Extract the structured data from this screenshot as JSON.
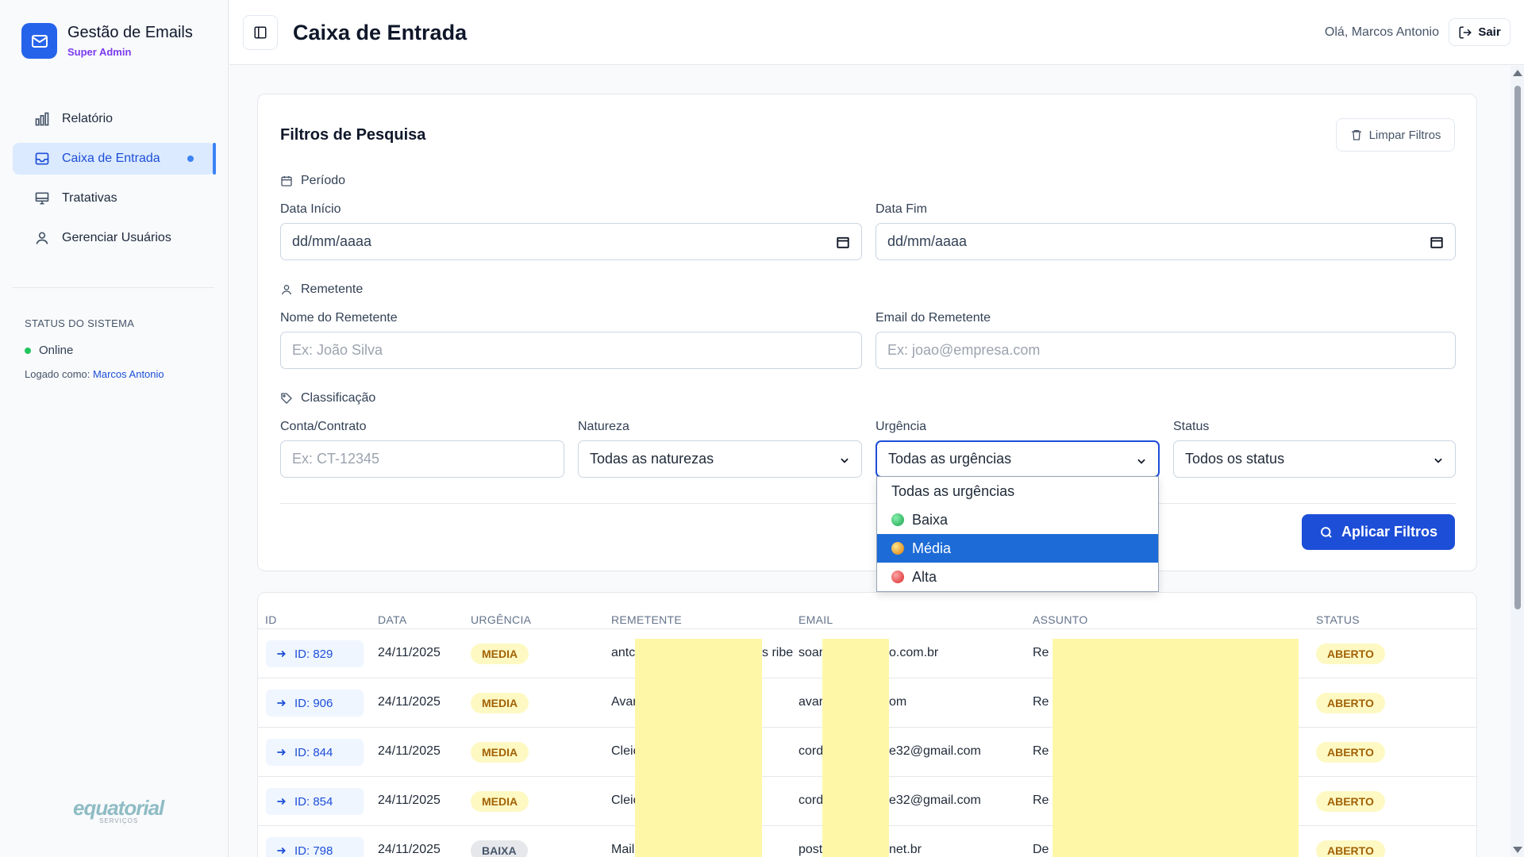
{
  "sidebar": {
    "brand_title": "Gestão de Emails",
    "brand_role": "Super Admin",
    "nav": [
      {
        "label": "Relatório",
        "icon": "bar-chart-icon"
      },
      {
        "label": "Caixa de Entrada",
        "icon": "inbox-icon",
        "active": true
      },
      {
        "label": "Tratativas",
        "icon": "monitor-icon"
      },
      {
        "label": "Gerenciar Usuários",
        "icon": "user-icon"
      }
    ],
    "status_title": "STATUS DO SISTEMA",
    "status_value": "Online",
    "logged_prefix": "Logado como:",
    "logged_user": "Marcos Antonio",
    "footer_logo": "equatorial",
    "footer_logo_sub": "SERVIÇOS"
  },
  "header": {
    "title": "Caixa de Entrada",
    "greeting": "Olá, Marcos Antonio",
    "logout_label": "Sair"
  },
  "filters": {
    "title": "Filtros de Pesquisa",
    "clear_label": "Limpar Filtros",
    "periodo_label": "Período",
    "data_inicio_label": "Data Início",
    "data_inicio_value": "dd/mm/aaaa",
    "data_fim_label": "Data Fim",
    "data_fim_value": "dd/mm/aaaa",
    "remetente_label": "Remetente",
    "nome_label": "Nome do Remetente",
    "nome_placeholder": "Ex: João Silva",
    "email_label": "Email do Remetente",
    "email_placeholder": "Ex: joao@empresa.com",
    "classificacao_label": "Classificação",
    "conta_label": "Conta/Contrato",
    "conta_placeholder": "Ex: CT-12345",
    "natureza_label": "Natureza",
    "natureza_value": "Todas as naturezas",
    "urgencia_label": "Urgência",
    "urgencia_value": "Todas as urgências",
    "status_label": "Status",
    "status_value": "Todos os status",
    "apply_label": "Aplicar Filtros"
  },
  "urgencia_dropdown": {
    "options": [
      {
        "label": "Todas as urgências",
        "color": ""
      },
      {
        "label": "Baixa",
        "color": "#22c55e"
      },
      {
        "label": "Média",
        "color": "#eab308",
        "selected": true
      },
      {
        "label": "Alta",
        "color": "#ef4444"
      }
    ]
  },
  "table": {
    "headers": [
      "ID",
      "DATA",
      "URGÊNCIA",
      "REMETENTE",
      "EMAIL",
      "ASSUNTO",
      "STATUS"
    ],
    "rows": [
      {
        "id": "ID: 829",
        "date": "24/11/2025",
        "urgency": "MEDIA",
        "sender_start": "antc",
        "sender_end": "s ribe",
        "email_start": "soar",
        "email_end": "o.com.br",
        "subject": "Re",
        "status": "ABERTO"
      },
      {
        "id": "ID: 906",
        "date": "24/11/2025",
        "urgency": "MEDIA",
        "sender_start": "Avar",
        "sender_end": "",
        "email_start": "avar",
        "email_end": "om",
        "subject": "Re",
        "status": "ABERTO"
      },
      {
        "id": "ID: 844",
        "date": "24/11/2025",
        "urgency": "MEDIA",
        "sender_start": "Cleic",
        "sender_end": "",
        "email_start": "cord",
        "email_end": "e32@gmail.com",
        "subject": "Re",
        "status": "ABERTO"
      },
      {
        "id": "ID: 854",
        "date": "24/11/2025",
        "urgency": "MEDIA",
        "sender_start": "Cleic",
        "sender_end": "",
        "email_start": "cord",
        "email_end": "e32@gmail.com",
        "subject": "Re",
        "status": "ABERTO"
      },
      {
        "id": "ID: 798",
        "date": "24/11/2025",
        "urgency": "BAIXA",
        "sender_start": "Mail",
        "sender_end": "",
        "email_start": "post",
        "email_end": "net.br",
        "subject": "De",
        "status": "ABERTO"
      }
    ]
  }
}
